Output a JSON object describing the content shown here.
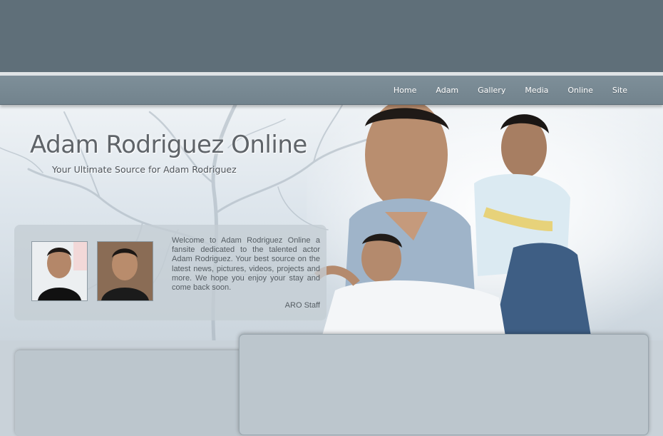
{
  "header": {
    "nav": [
      {
        "label": "Home"
      },
      {
        "label": "Adam"
      },
      {
        "label": "Gallery"
      },
      {
        "label": "Media"
      },
      {
        "label": "Online"
      },
      {
        "label": "Site"
      }
    ]
  },
  "banner": {
    "title": "Adam Rodriguez Online",
    "tagline": "Your Ultimate Source for Adam Rodriguez"
  },
  "welcome": {
    "text": "Welcome to Adam Rodriguez Online a fansite dedicated to the talented actor Adam Rodriguez. Your best source on the latest news, pictures, videos, projects and more. We hope you enjoy your stay and come back soon.",
    "signature": "ARO Staff"
  },
  "colors": {
    "header_bg": "#5f6f79",
    "nav_bg": "#7e8f99",
    "nav_text": "#ffffff",
    "panel_bg": "#bcc6cd",
    "title_text": "#5f6469"
  }
}
